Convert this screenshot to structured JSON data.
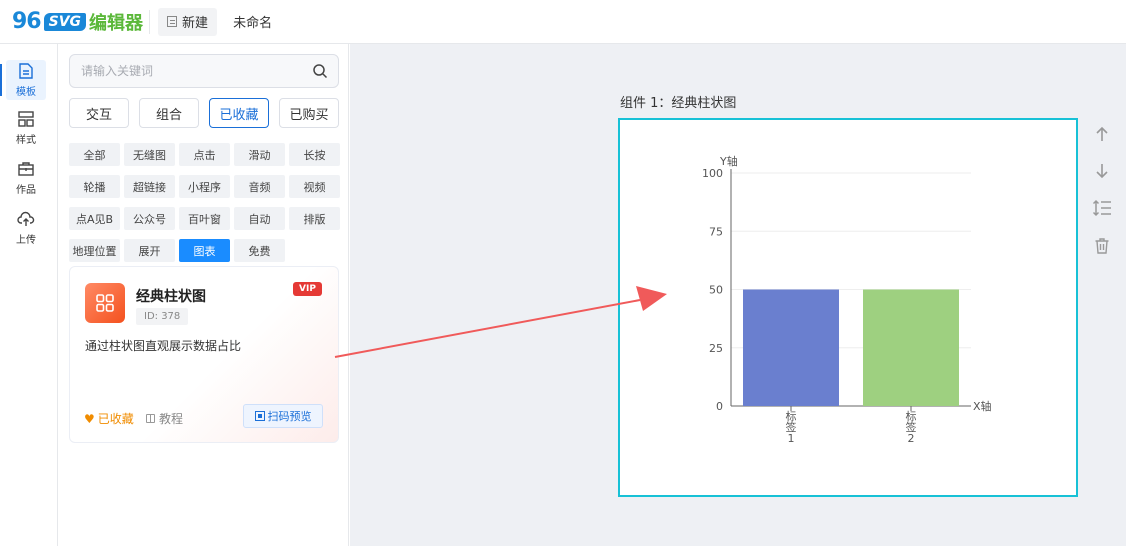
{
  "header": {
    "logo_num": "96",
    "logo_svg": "SVG",
    "logo_name": "编辑器",
    "new_label": "新建",
    "doc_name": "未命名"
  },
  "nav": [
    {
      "label": "模板",
      "icon": "template-icon",
      "active": true
    },
    {
      "label": "样式",
      "icon": "style-icon",
      "active": false
    },
    {
      "label": "作品",
      "icon": "briefcase-icon",
      "active": false
    },
    {
      "label": "上传",
      "icon": "cloud-upload-icon",
      "active": false
    }
  ],
  "search": {
    "placeholder": "请输入关键词"
  },
  "tabs": [
    {
      "label": "交互",
      "active": false
    },
    {
      "label": "组合",
      "active": false
    },
    {
      "label": "已收藏",
      "active": true
    },
    {
      "label": "已购买",
      "active": false
    }
  ],
  "tags": [
    {
      "label": "全部",
      "active": false
    },
    {
      "label": "无缝图",
      "active": false
    },
    {
      "label": "点击",
      "active": false
    },
    {
      "label": "滑动",
      "active": false
    },
    {
      "label": "长按",
      "active": false
    },
    {
      "label": "轮播",
      "active": false
    },
    {
      "label": "超链接",
      "active": false
    },
    {
      "label": "小程序",
      "active": false
    },
    {
      "label": "音频",
      "active": false
    },
    {
      "label": "视频",
      "active": false
    },
    {
      "label": "点A见B",
      "active": false
    },
    {
      "label": "公众号",
      "active": false
    },
    {
      "label": "百叶窗",
      "active": false
    },
    {
      "label": "自动",
      "active": false
    },
    {
      "label": "排版",
      "active": false
    },
    {
      "label": "地理位置",
      "active": false
    },
    {
      "label": "展开",
      "active": false
    },
    {
      "label": "图表",
      "active": true
    },
    {
      "label": "免费",
      "active": false
    }
  ],
  "card": {
    "title": "经典柱状图",
    "id_text": "ID: 378",
    "vip": "VIP",
    "desc": "通过柱状图直观展示数据占比",
    "fav_label": "已收藏",
    "tutorial_label": "教程",
    "qr_label": "扫码预览"
  },
  "component_label": "组件 1：经典柱状图",
  "colors": {
    "accent": "#1a6fd8",
    "stage_border": "#17c1d6",
    "arrow": "#f05a5a"
  },
  "chart_data": {
    "type": "bar",
    "categories": [
      "标签1",
      "标签2"
    ],
    "category_lines": [
      [
        "标",
        "签",
        "1"
      ],
      [
        "标",
        "签",
        "2"
      ]
    ],
    "values": [
      50,
      50
    ],
    "bar_colors": [
      "#6a7fcf",
      "#9ed080"
    ],
    "ylabel": "Y轴",
    "xlabel": "X轴",
    "ylim": [
      0,
      100
    ],
    "yticks": [
      0,
      25,
      50,
      75,
      100
    ],
    "grid": true
  }
}
